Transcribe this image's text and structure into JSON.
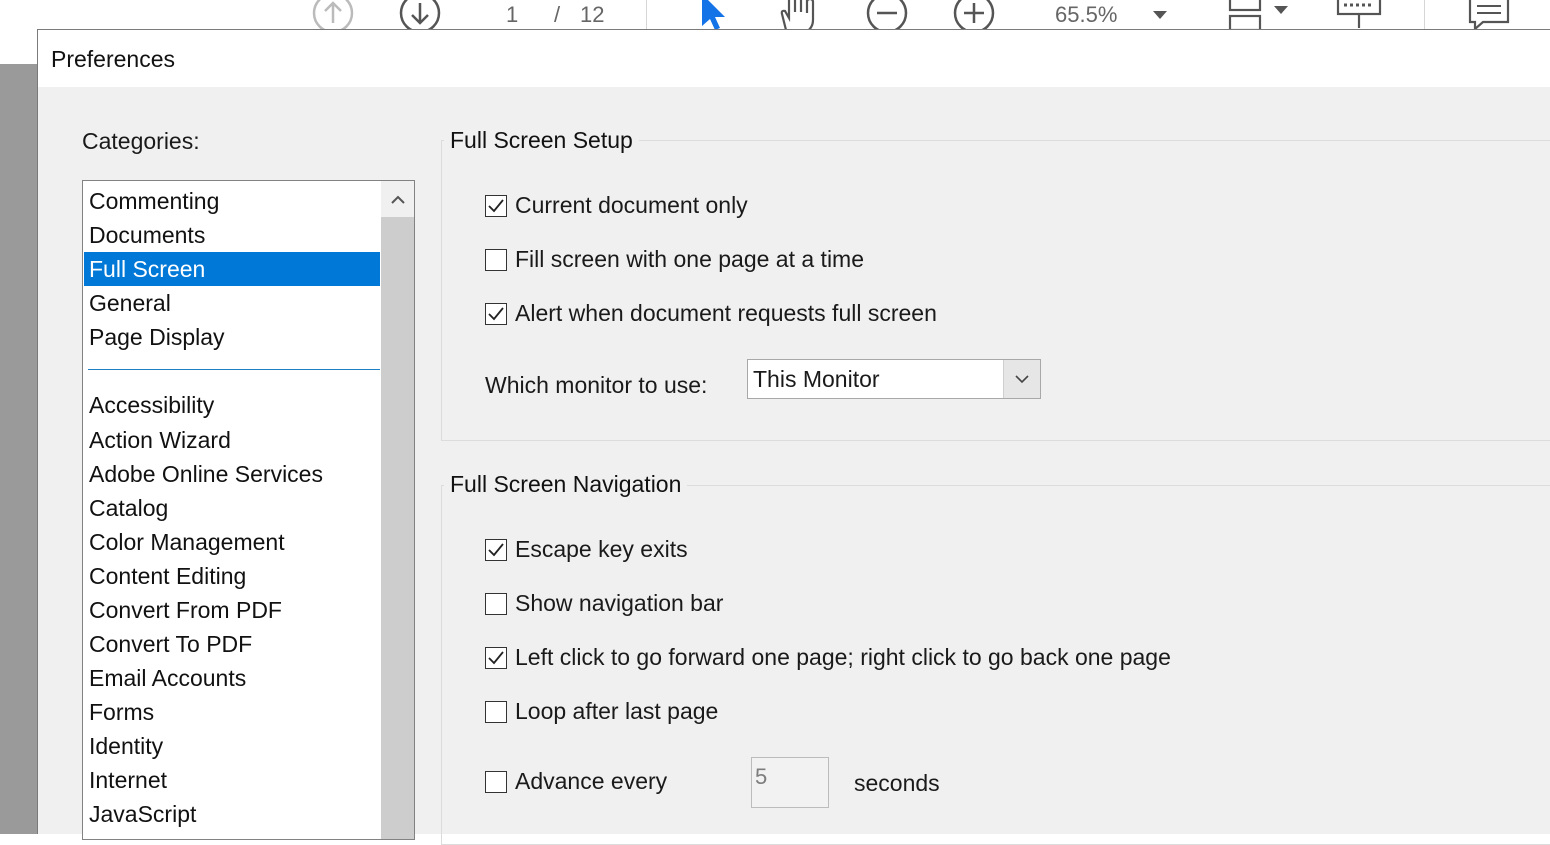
{
  "toolbar": {
    "page_current": "1",
    "page_separator": "/",
    "page_total": "12",
    "zoom": "65.5%",
    "icons": [
      "arrow-up-circle-icon",
      "arrow-down-circle-icon",
      "select-pointer-icon",
      "hand-tool-icon",
      "zoom-out-icon",
      "zoom-in-icon",
      "dropdown-caret-icon",
      "page-layout-icon",
      "keyboard-icon",
      "comment-icon"
    ]
  },
  "dialog": {
    "title": "Preferences",
    "categories_label": "Categories:",
    "categories_top": [
      "Commenting",
      "Documents",
      "Full Screen",
      "General",
      "Page Display"
    ],
    "categories_bottom": [
      "Accessibility",
      "Action Wizard",
      "Adobe Online Services",
      "Catalog",
      "Color Management",
      "Content Editing",
      "Convert From PDF",
      "Convert To PDF",
      "Email Accounts",
      "Forms",
      "Identity",
      "Internet",
      "JavaScript"
    ],
    "selected_category": "Full Screen",
    "setup": {
      "title": "Full Screen Setup",
      "current_document_only": {
        "label": "Current document only",
        "checked": true
      },
      "fill_screen": {
        "label": "Fill screen with one page at a time",
        "checked": false
      },
      "alert_full_screen": {
        "label": "Alert when document requests full screen",
        "checked": true
      },
      "monitor_label": "Which monitor to use:",
      "monitor_value": "This Monitor"
    },
    "navigation": {
      "title": "Full Screen Navigation",
      "escape_exits": {
        "label": "Escape key exits",
        "checked": true
      },
      "show_nav_bar": {
        "label": "Show navigation bar",
        "checked": false
      },
      "left_click": {
        "label": "Left click to go forward one page; right click to go back one page",
        "checked": true
      },
      "loop": {
        "label": "Loop after last page",
        "checked": false
      },
      "advance": {
        "label": "Advance every",
        "checked": false
      },
      "advance_value": "5",
      "seconds_label": "seconds"
    }
  },
  "colors": {
    "accent": "#0078d7",
    "dialog_bg": "#f0f0f0",
    "pointer": "#1473e6"
  }
}
